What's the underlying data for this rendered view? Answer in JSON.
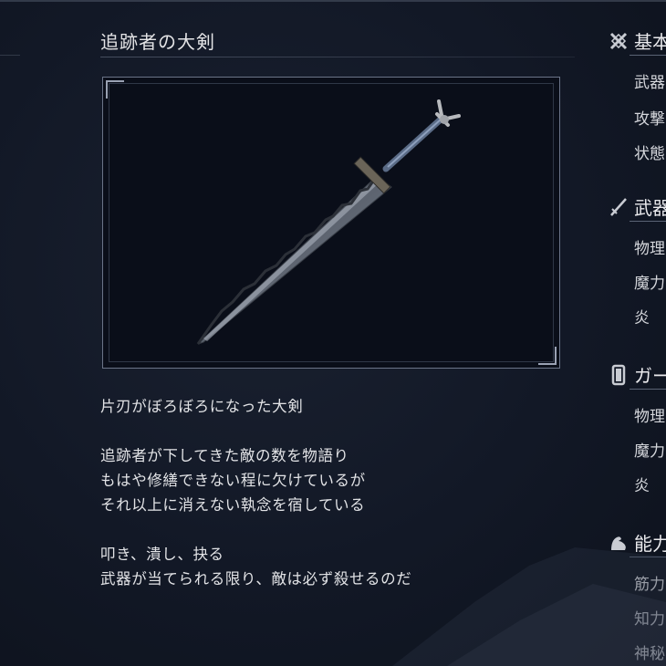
{
  "item": {
    "name": "追跡者の大剣",
    "description": [
      "片刃がぼろぼろになった大剣",
      "",
      "追跡者が下してきた敵の数を物語り",
      "もはや修繕できない程に欠けているが",
      "それ以上に消えない執念を宿している",
      "",
      "叩き、潰し、抉る",
      "武器が当てられる限り、敵は必ず殺せるのだ"
    ]
  },
  "sidebar": {
    "sections": [
      {
        "icon": "crossed-swords-icon",
        "title": "基本",
        "rows": [
          "武器",
          "攻撃",
          "状態"
        ]
      },
      {
        "icon": "sword-icon",
        "title": "武器",
        "rows": [
          "物理",
          "魔力",
          "炎"
        ]
      },
      {
        "icon": "shield-icon",
        "title": "ガー",
        "rows": [
          "物理",
          "魔力",
          "炎"
        ]
      },
      {
        "icon": "arm-icon",
        "title": "能力",
        "rows": [
          "筋力",
          "知力",
          "神秘"
        ]
      }
    ]
  }
}
